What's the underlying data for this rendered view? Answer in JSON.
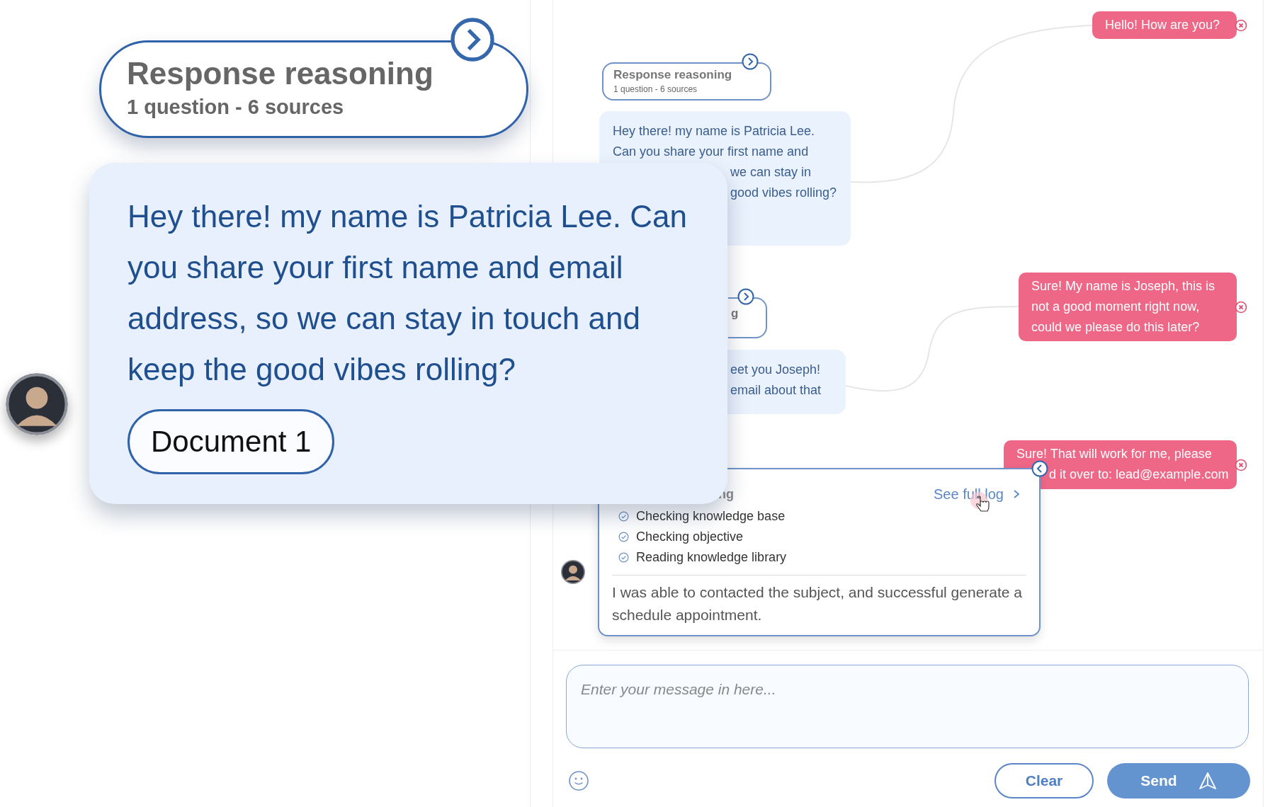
{
  "callouts": {
    "reasoning": {
      "title": "Response reasoning",
      "subtitle": "1 question - 6 sources"
    },
    "message": {
      "text": "Hey there! my name is Patricia Lee. Can you share your first name and email address, so we can stay in touch and keep the good vibes rolling?",
      "document": "Document 1"
    }
  },
  "chat": {
    "messages": [
      {
        "kind": "user",
        "lines": [
          "Hello! How are you?"
        ]
      },
      {
        "kind": "reasoning",
        "title": "Response reasoning",
        "subtitle": "1 question - 6 sources"
      },
      {
        "kind": "agent",
        "lines": [
          "Hey there! my name is Patricia Lee.",
          "Can you share your first name and",
          "we can stay in",
          "good vibes rolling?"
        ]
      },
      {
        "kind": "user",
        "lines": [
          "Sure! My name is Joseph, this is",
          "not a good moment right now,",
          "could we please do this later?"
        ]
      },
      {
        "kind": "reasoning",
        "title": "g"
      },
      {
        "kind": "agent",
        "lines": [
          "eet you Joseph!",
          "email about that"
        ]
      },
      {
        "kind": "user",
        "lines": [
          "Sure! That will work for me, please",
          "d it over to: lead@example.com"
        ]
      },
      {
        "kind": "log",
        "title": "ng",
        "link": "See full log",
        "steps": [
          {
            "label": "Checking knowledge base",
            "done": true
          },
          {
            "label": "Checking objective",
            "done": true
          },
          {
            "label": "Reading knowledge library",
            "done": true
          }
        ],
        "summary": "I was able to contacted the subject, and successful generate a schedule appointment."
      }
    ]
  },
  "composer": {
    "placeholder": "Enter your message in here...",
    "buttons": [
      {
        "label": "Clear",
        "kind": "secondary"
      },
      {
        "label": "Send",
        "kind": "primary"
      }
    ]
  }
}
